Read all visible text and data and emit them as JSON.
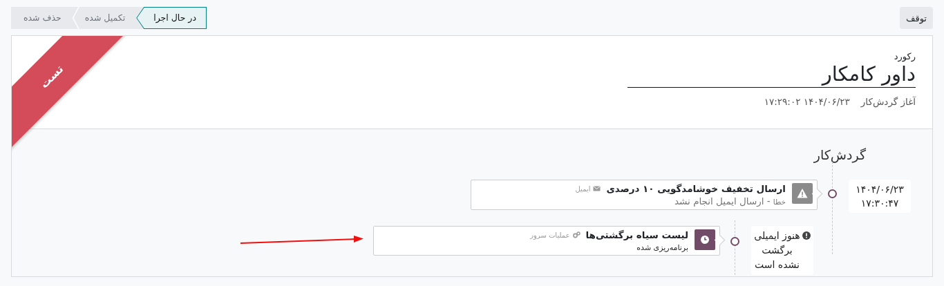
{
  "stop_button": "توقف",
  "stages": [
    {
      "label": "در حال اجرا",
      "selected": true
    },
    {
      "label": "تکمیل شده",
      "selected": false
    },
    {
      "label": "حذف شده",
      "selected": false
    }
  ],
  "ribbon": "تست",
  "record": {
    "label": "رکورد",
    "name": "داور کامکار"
  },
  "fields": [
    {
      "label": "آغاز گردش‌کار",
      "value": "۱۴۰۴/۰۶/۲۳ ۱۷:۲۹:۰۲"
    }
  ],
  "timeline": {
    "title": "گردش‌کار",
    "items": [
      {
        "kind": "error",
        "date": "۱۴۰۴/۰۶/۲۳",
        "time": "۱۷:۳۰:۴۷",
        "title": "ارسال تخفیف خوشامدگویی ۱۰ درصدی",
        "action": {
          "kind": "email",
          "label": "ایمیل"
        },
        "status": "خطا",
        "message": "- ارسال ایمیل انجام نشد",
        "children": [
          {
            "kind": "scheduled",
            "note": "هنوز ایمیلی برگشت نشده است",
            "title": "لیست سیاه برگشتی‌ها",
            "action": {
              "kind": "server",
              "label": "عملیات سرور"
            },
            "status": "برنامه‌ریزی شده"
          }
        ]
      }
    ]
  }
}
